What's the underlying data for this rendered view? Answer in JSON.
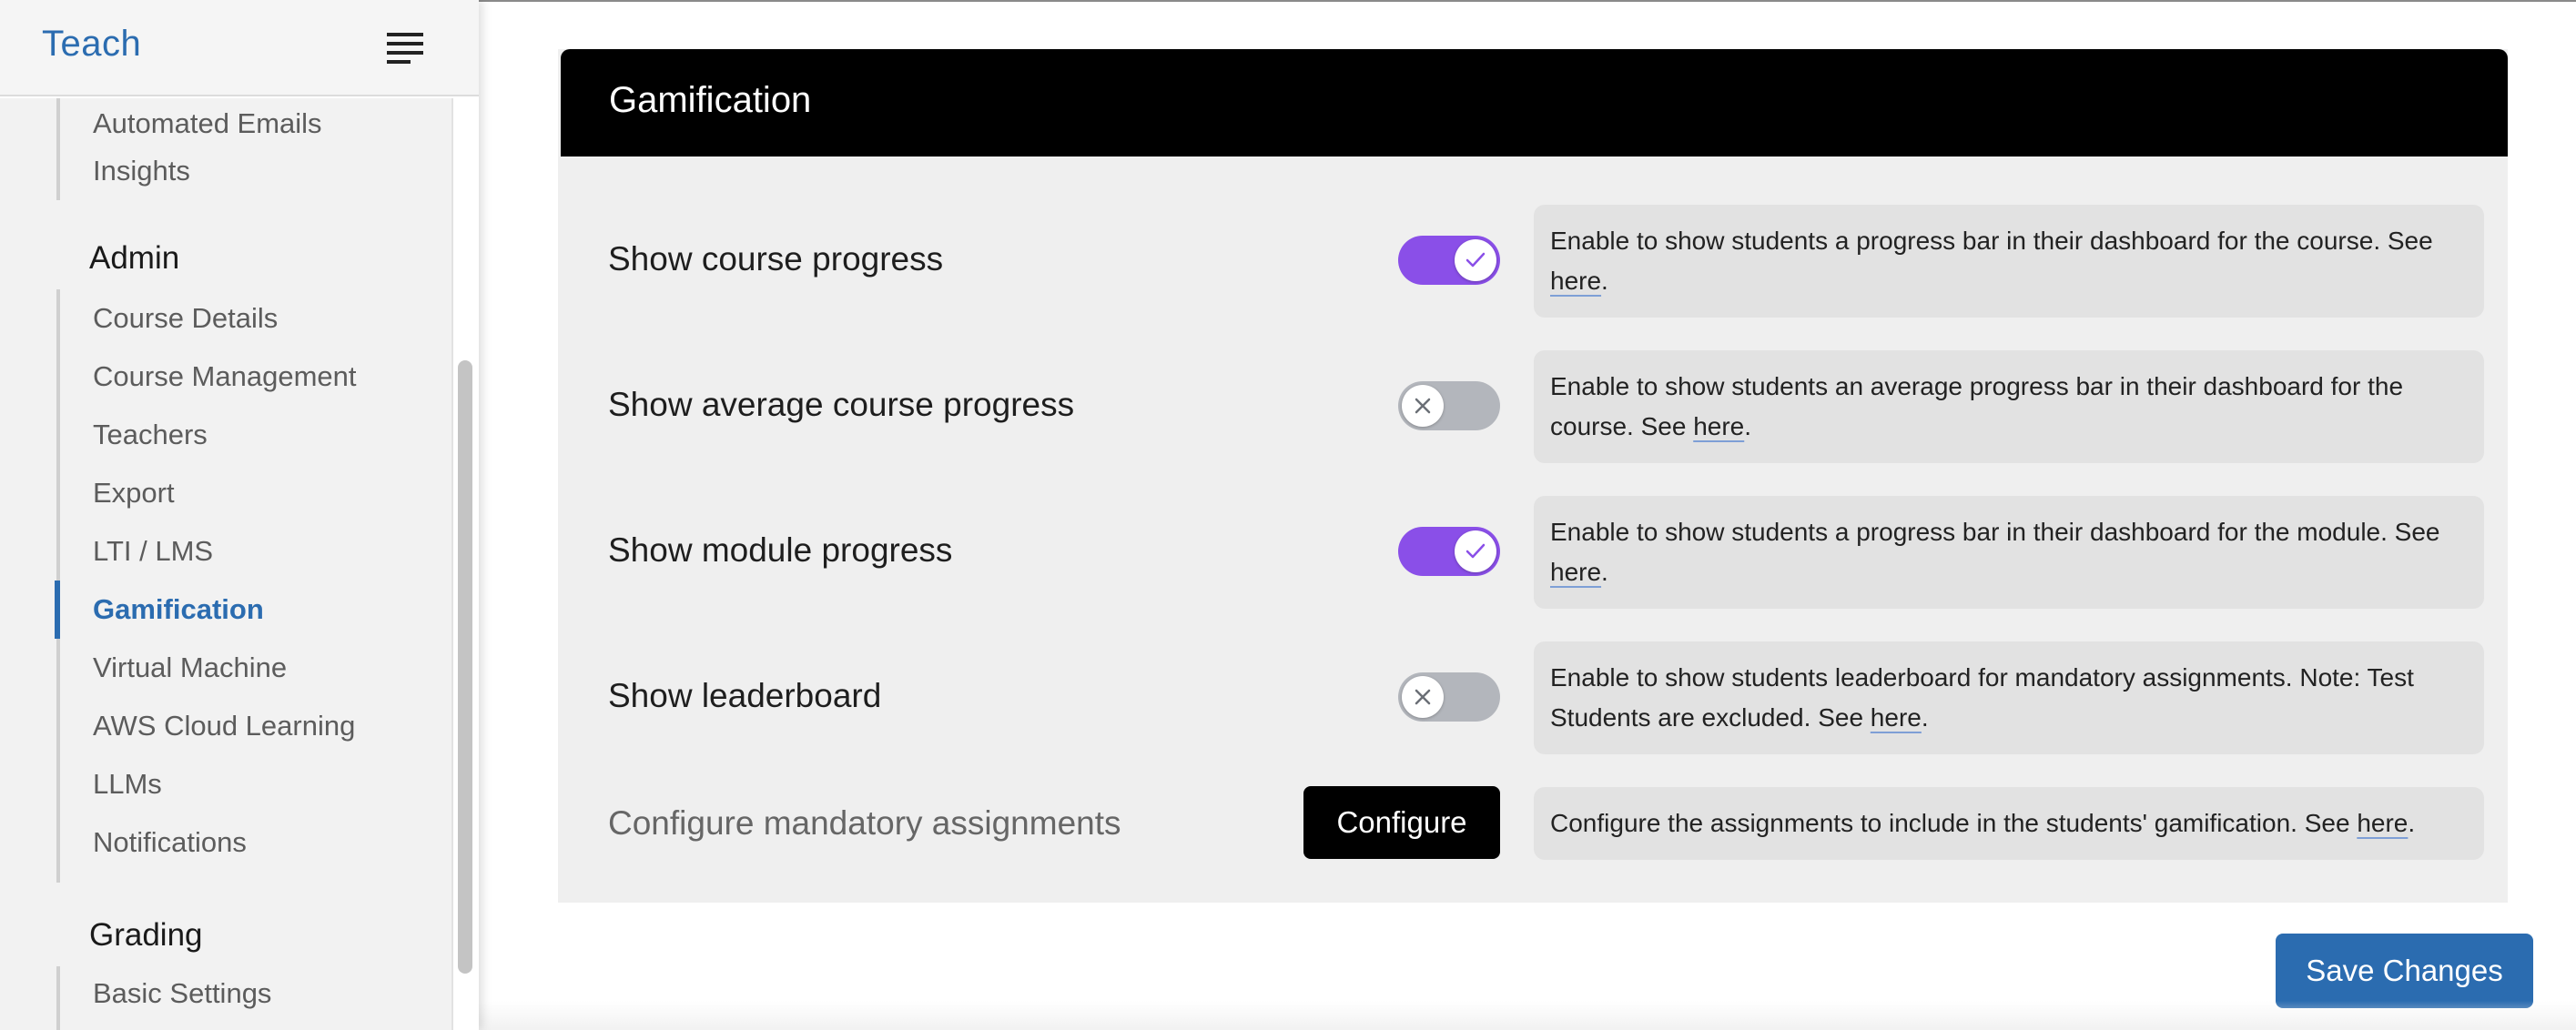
{
  "sidebar": {
    "title": "Teach",
    "sections": {
      "top_items": [
        "Automated Emails",
        "Insights"
      ],
      "admin": {
        "title": "Admin",
        "items": [
          "Course Details",
          "Course Management",
          "Teachers",
          "Export",
          "LTI / LMS",
          "Gamification",
          "Virtual Machine",
          "AWS Cloud Learning",
          "LLMs",
          "Notifications"
        ],
        "active": "Gamification"
      },
      "grading": {
        "title": "Grading",
        "items": [
          "Basic Settings"
        ]
      }
    }
  },
  "panel": {
    "title": "Gamification",
    "rows": [
      {
        "label": "Show course progress",
        "enabled": true,
        "desc_text": "Enable to show students a progress bar in their dashboard for the course. See ",
        "link": "here",
        "desc_end": "."
      },
      {
        "label": "Show average course progress",
        "enabled": false,
        "desc_text": "Enable to show students an average progress bar in their dashboard for the course. See ",
        "link": "here",
        "desc_end": "."
      },
      {
        "label": "Show module progress",
        "enabled": true,
        "desc_text": "Enable to show students a progress bar in their dashboard for the module. See ",
        "link": "here",
        "desc_end": "."
      },
      {
        "label": "Show leaderboard",
        "enabled": false,
        "desc_text": "Enable to show students leaderboard for mandatory assignments. Note: Test Students are excluded. See ",
        "link": "here",
        "desc_end": "."
      }
    ],
    "configure_row": {
      "label": "Configure mandatory assignments",
      "button_label": "Configure",
      "desc_text": "Configure the assignments to include in the students' gamification. See ",
      "link": "here",
      "desc_end": "."
    }
  },
  "save_button_label": "Save Changes",
  "colors": {
    "accent_blue": "#2b6cb0",
    "toggle_on": "#8a4fe8",
    "toggle_off": "#b3b6bc",
    "header_black": "#000000"
  },
  "icons": {
    "menu": "menu-lines-icon",
    "toggle_on": "check-icon",
    "toggle_off": "x-icon"
  }
}
